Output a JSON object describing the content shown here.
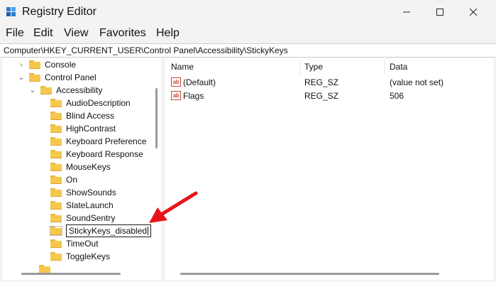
{
  "window": {
    "title": "Registry Editor",
    "controls": {
      "minimize": "—",
      "maximize": "☐",
      "close": "✕"
    }
  },
  "menu": {
    "items": [
      "File",
      "Edit",
      "View",
      "Favorites",
      "Help"
    ]
  },
  "address": {
    "path": "Computer\\HKEY_CURRENT_USER\\Control Panel\\Accessibility\\StickyKeys"
  },
  "tree": {
    "items": [
      {
        "label": "Console",
        "chevron": "›"
      },
      {
        "label": "Control Panel",
        "chevron": "⌄"
      },
      {
        "label": "Accessibility",
        "chevron": "⌄"
      },
      {
        "label": "AudioDescription"
      },
      {
        "label": "Blind Access"
      },
      {
        "label": "HighContrast"
      },
      {
        "label": "Keyboard Preference"
      },
      {
        "label": "Keyboard Response"
      },
      {
        "label": "MouseKeys"
      },
      {
        "label": "On"
      },
      {
        "label": "ShowSounds"
      },
      {
        "label": "SlateLaunch"
      },
      {
        "label": "SoundSentry"
      },
      {
        "label": "StickyKeys_disabled",
        "editing": true
      },
      {
        "label": "TimeOut"
      },
      {
        "label": "ToggleKeys"
      }
    ]
  },
  "values_list": {
    "columns": {
      "name": "Name",
      "type": "Type",
      "data": "Data"
    },
    "icon_text": "ab",
    "rows": [
      {
        "name": "(Default)",
        "type": "REG_SZ",
        "data": "(value not set)"
      },
      {
        "name": "Flags",
        "type": "REG_SZ",
        "data": "506"
      }
    ]
  },
  "colors": {
    "folder": "#f5c84c",
    "annotation_arrow": "#e8141b"
  },
  "icons": {
    "app": "registry-cube-icon",
    "annotation": "red-arrow-icon"
  }
}
